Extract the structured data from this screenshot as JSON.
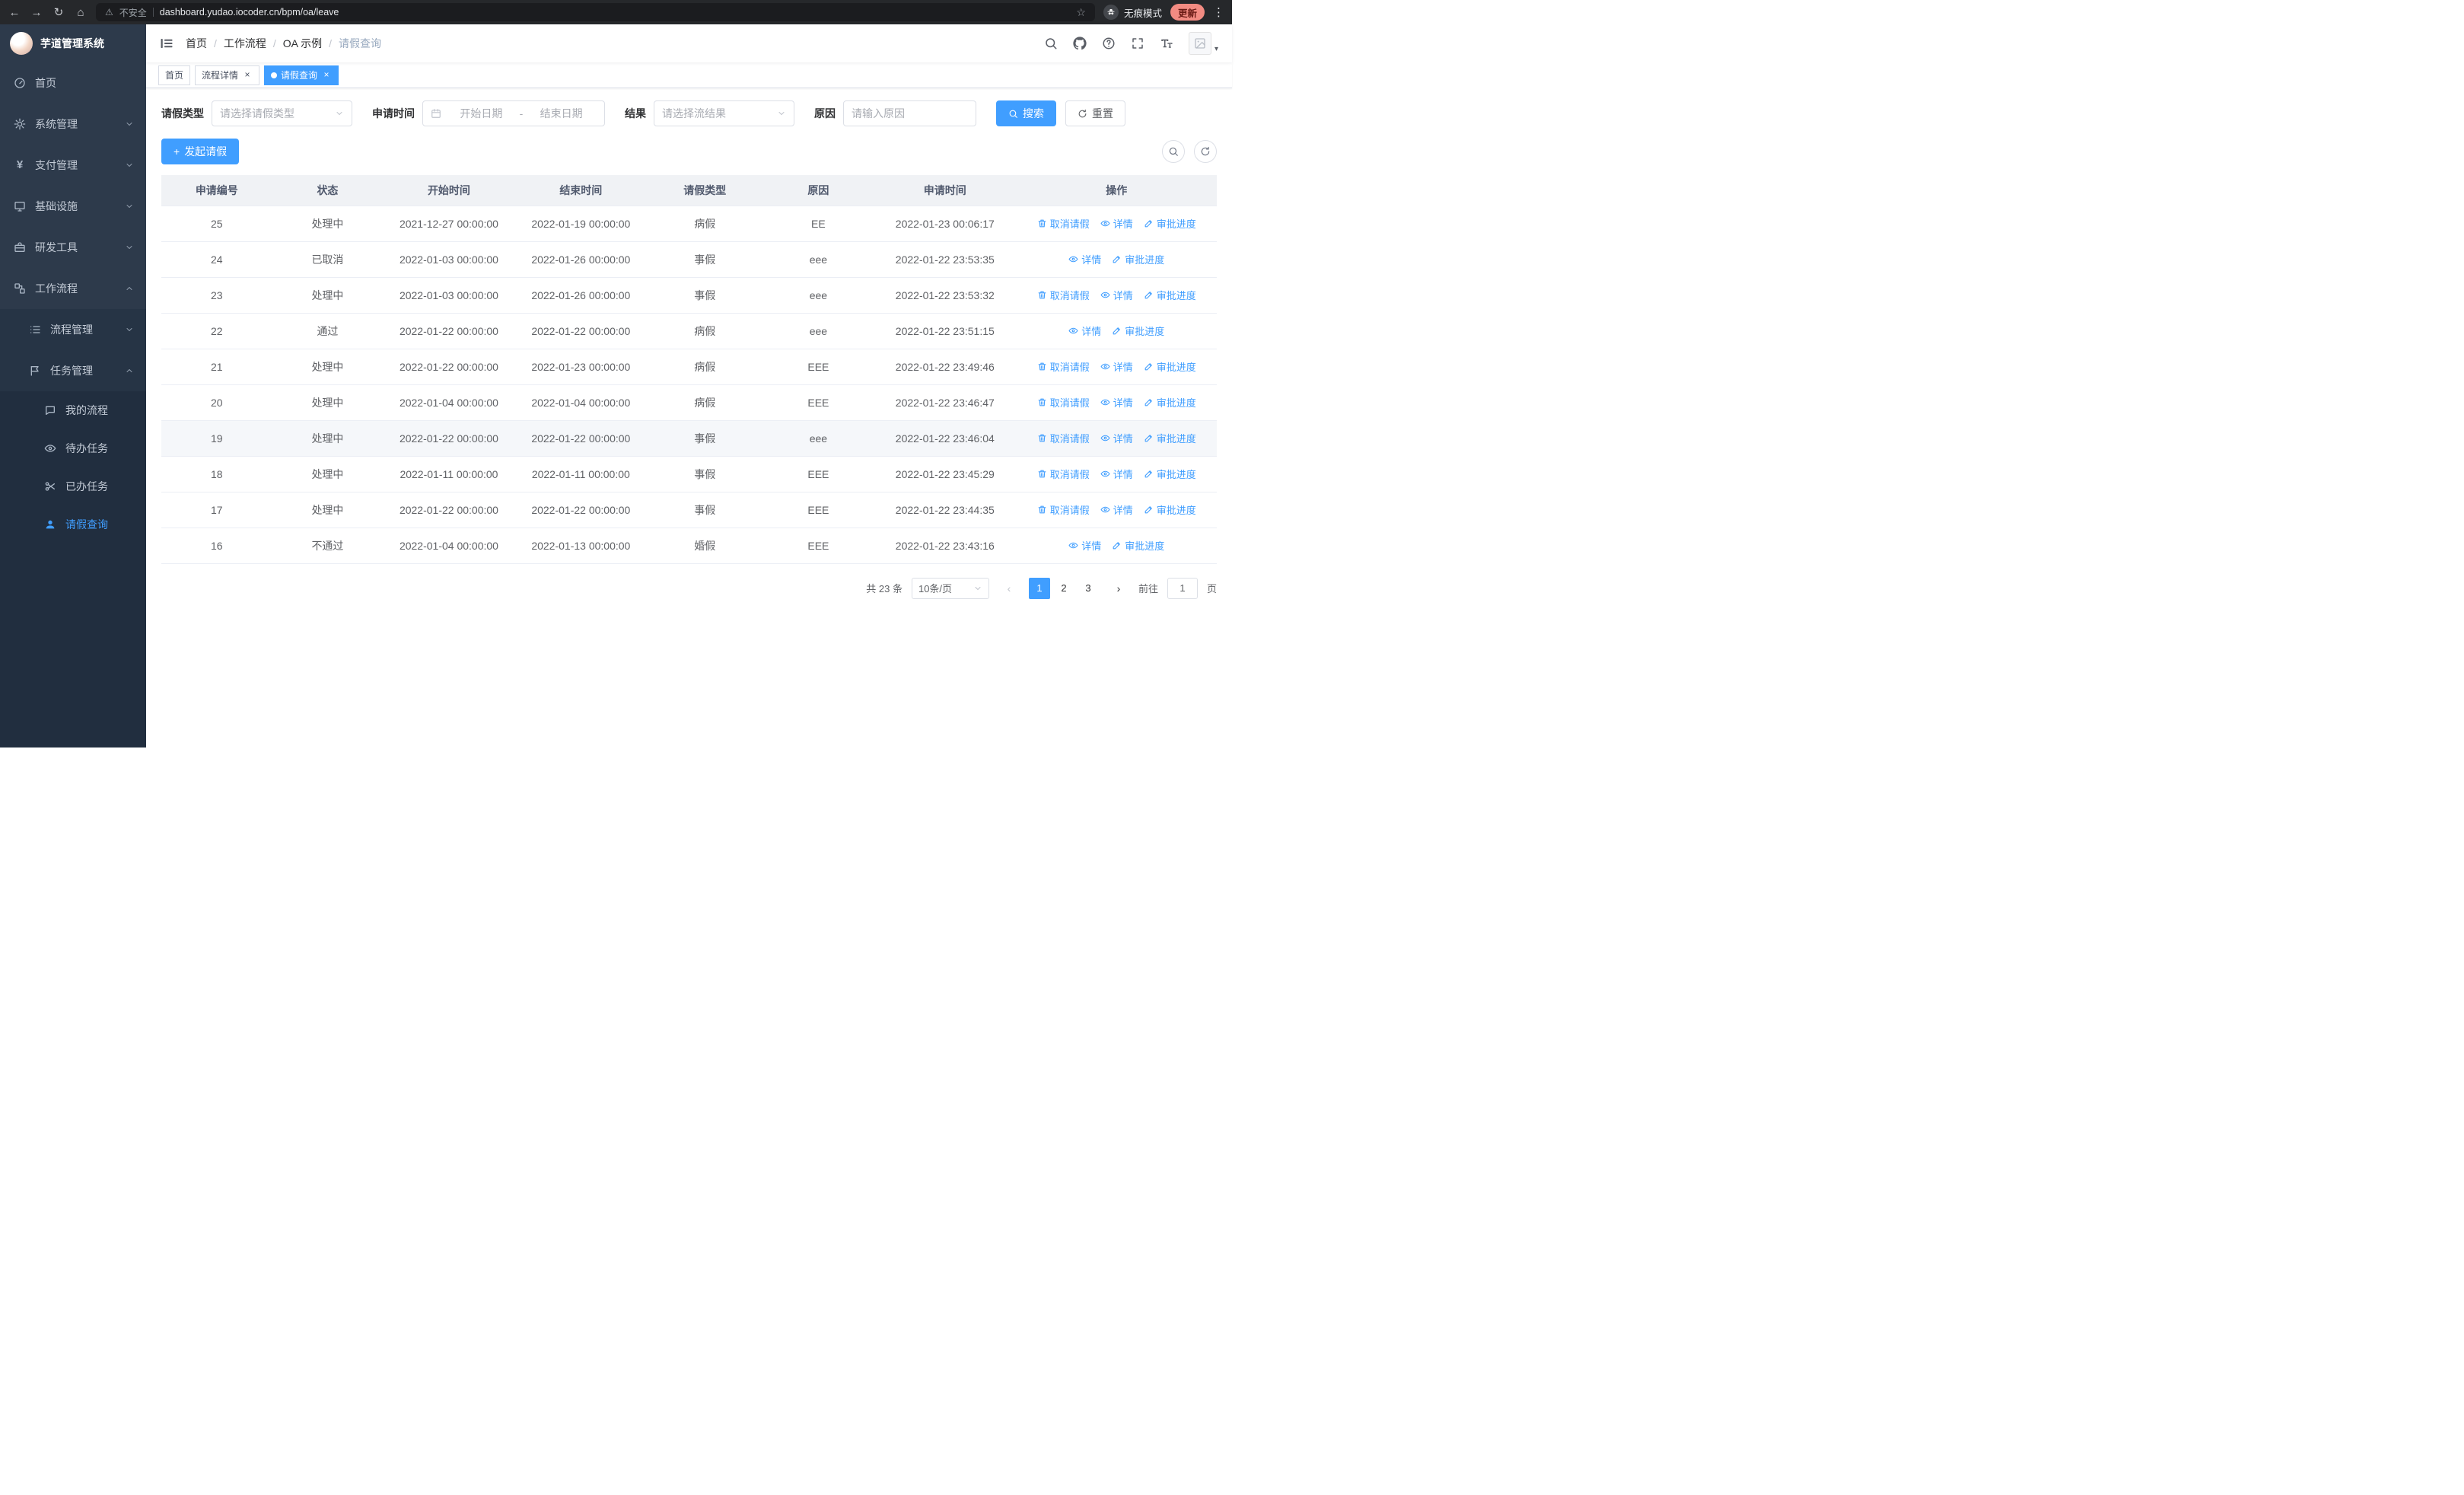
{
  "browser": {
    "security_label": "不安全",
    "url": "dashboard.yudao.iocoder.cn/bpm/oa/leave",
    "incognito_label": "无痕模式",
    "update_label": "更新"
  },
  "sidebar": {
    "app_title": "芋道管理系统",
    "items": [
      {
        "label": "首页"
      },
      {
        "label": "系统管理"
      },
      {
        "label": "支付管理"
      },
      {
        "label": "基础设施"
      },
      {
        "label": "研发工具"
      },
      {
        "label": "工作流程"
      },
      {
        "label": "流程管理"
      },
      {
        "label": "任务管理"
      },
      {
        "label": "我的流程"
      },
      {
        "label": "待办任务"
      },
      {
        "label": "已办任务"
      },
      {
        "label": "请假查询"
      }
    ]
  },
  "header": {
    "breadcrumb": [
      "首页",
      "工作流程",
      "OA 示例",
      "请假查询"
    ],
    "separator": "/"
  },
  "tabs": [
    {
      "label": "首页"
    },
    {
      "label": "流程详情"
    },
    {
      "label": "请假查询"
    }
  ],
  "filters": {
    "leave_type_label": "请假类型",
    "leave_type_placeholder": "请选择请假类型",
    "apply_time_label": "申请时间",
    "start_placeholder": "开始日期",
    "range_separator": "-",
    "end_placeholder": "结束日期",
    "result_label": "结果",
    "result_placeholder": "请选择流结果",
    "reason_label": "原因",
    "reason_placeholder": "请输入原因",
    "search_label": "搜索",
    "reset_label": "重置"
  },
  "toolbar": {
    "create_label": "发起请假"
  },
  "table": {
    "headers": [
      "申请编号",
      "状态",
      "开始时间",
      "结束时间",
      "请假类型",
      "原因",
      "申请时间",
      "操作"
    ],
    "action_labels": {
      "cancel": "取消请假",
      "detail": "详情",
      "progress": "审批进度"
    },
    "rows": [
      {
        "id": "25",
        "status": "处理中",
        "start": "2021-12-27 00:00:00",
        "end": "2022-01-19 00:00:00",
        "type": "病假",
        "reason": "EE",
        "apply_time": "2022-01-23 00:06:17",
        "actions": [
          "cancel",
          "detail",
          "progress"
        ]
      },
      {
        "id": "24",
        "status": "已取消",
        "start": "2022-01-03 00:00:00",
        "end": "2022-01-26 00:00:00",
        "type": "事假",
        "reason": "eee",
        "apply_time": "2022-01-22 23:53:35",
        "actions": [
          "detail",
          "progress"
        ]
      },
      {
        "id": "23",
        "status": "处理中",
        "start": "2022-01-03 00:00:00",
        "end": "2022-01-26 00:00:00",
        "type": "事假",
        "reason": "eee",
        "apply_time": "2022-01-22 23:53:32",
        "actions": [
          "cancel",
          "detail",
          "progress"
        ]
      },
      {
        "id": "22",
        "status": "通过",
        "start": "2022-01-22 00:00:00",
        "end": "2022-01-22 00:00:00",
        "type": "病假",
        "reason": "eee",
        "apply_time": "2022-01-22 23:51:15",
        "actions": [
          "detail",
          "progress"
        ]
      },
      {
        "id": "21",
        "status": "处理中",
        "start": "2022-01-22 00:00:00",
        "end": "2022-01-23 00:00:00",
        "type": "病假",
        "reason": "EEE",
        "apply_time": "2022-01-22 23:49:46",
        "actions": [
          "cancel",
          "detail",
          "progress"
        ]
      },
      {
        "id": "20",
        "status": "处理中",
        "start": "2022-01-04 00:00:00",
        "end": "2022-01-04 00:00:00",
        "type": "病假",
        "reason": "EEE",
        "apply_time": "2022-01-22 23:46:47",
        "actions": [
          "cancel",
          "detail",
          "progress"
        ]
      },
      {
        "id": "19",
        "status": "处理中",
        "start": "2022-01-22 00:00:00",
        "end": "2022-01-22 00:00:00",
        "type": "事假",
        "reason": "eee",
        "apply_time": "2022-01-22 23:46:04",
        "actions": [
          "cancel",
          "detail",
          "progress"
        ],
        "hover": true
      },
      {
        "id": "18",
        "status": "处理中",
        "start": "2022-01-11 00:00:00",
        "end": "2022-01-11 00:00:00",
        "type": "事假",
        "reason": "EEE",
        "apply_time": "2022-01-22 23:45:29",
        "actions": [
          "cancel",
          "detail",
          "progress"
        ]
      },
      {
        "id": "17",
        "status": "处理中",
        "start": "2022-01-22 00:00:00",
        "end": "2022-01-22 00:00:00",
        "type": "事假",
        "reason": "EEE",
        "apply_time": "2022-01-22 23:44:35",
        "actions": [
          "cancel",
          "detail",
          "progress"
        ]
      },
      {
        "id": "16",
        "status": "不通过",
        "start": "2022-01-04 00:00:00",
        "end": "2022-01-13 00:00:00",
        "type": "婚假",
        "reason": "EEE",
        "apply_time": "2022-01-22 23:43:16",
        "actions": [
          "detail",
          "progress"
        ]
      }
    ]
  },
  "pagination": {
    "total": "共 23 条",
    "page_size": "10条/页",
    "pages": [
      "1",
      "2",
      "3"
    ],
    "active_page": "1",
    "goto_label": "前往",
    "goto_value": "1",
    "page_label": "页"
  },
  "colors": {
    "primary": "#409eff",
    "sidebar_bg": "#2d3a4b",
    "update_pill": "#f28b82"
  }
}
